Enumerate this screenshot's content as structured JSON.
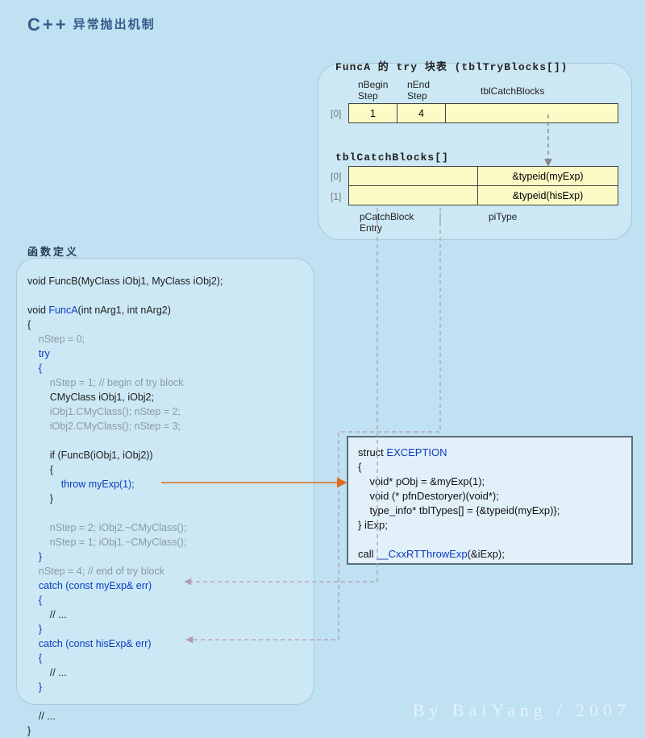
{
  "title_cpp": "C++",
  "title_rest": "异常抛出机制",
  "func_panel_label": "函数定义",
  "tryTable": {
    "title": "FuncA 的 try 块表 (tblTryBlocks[])",
    "headers": {
      "c1": "nBegin\nStep",
      "c2": "nEnd\nStep",
      "c3": "tblCatchBlocks"
    },
    "idx0": "[0]",
    "row": {
      "c1": "1",
      "c2": "4",
      "c3": ""
    }
  },
  "catchTable": {
    "title": "tblCatchBlocks[]",
    "idx0": "[0]",
    "idx1": "[1]",
    "row0": {
      "c1": "",
      "c2": "&typeid(myExp)"
    },
    "row1": {
      "c1": "",
      "c2": "&typeid(hisExp)"
    },
    "footer": {
      "left": "pCatchBlock\nEntry",
      "right": "piType"
    }
  },
  "code": {
    "l1": "void FuncB(MyClass iObj1, MyClass iObj2);",
    "l2a": "void ",
    "l2b": "FuncA",
    "l2c": "(int nArg1, int nArg2)",
    "l3": "{",
    "l4": "    nStep = 0;",
    "l5": "    try",
    "l6": "    {",
    "l7": "        nStep = 1; // begin of try block",
    "l8": "        CMyClass iObj1, iObj2;",
    "l9": "        iObj1.CMyClass(); nStep = 2;",
    "l10": "        iObj2.CMyClass(); nStep = 3;",
    "l11": "",
    "l12": "        if (FuncB(iObj1, iObj2))",
    "l13": "        {",
    "l14a": "            ",
    "l14b": "throw myExp(1);",
    "l15": "        }",
    "l16": "",
    "l17": "        nStep = 2; iObj2.~CMyClass();",
    "l18": "        nStep = 1; iObj1.~CMyClass();",
    "l19": "    }",
    "l20": "    nStep = 4; // end of try block",
    "l21": "    catch (const myExp& err)",
    "l22": "    {",
    "l23": "        // ...",
    "l24": "    }",
    "l25": "    catch (const hisExp& err)",
    "l26": "    {",
    "l27": "        // ...",
    "l28": "    }",
    "l29": "",
    "l30": "    // ...",
    "l31": "}"
  },
  "exc": {
    "l1a": "struct ",
    "l1b": "EXCEPTION",
    "l2": "{",
    "l3": "    void* pObj = &myExp(1);",
    "l4": "    void (* pfnDestoryer)(void*);",
    "l5": "    type_info* tblTypes[] = {&typeid(myExp)};",
    "l6": "} iExp;",
    "l7": "",
    "l8a": "call ",
    "l8b": "__CxxRTThrowExp",
    "l8c": "(&iExp);"
  },
  "footer": "By BaiYang / 2007"
}
